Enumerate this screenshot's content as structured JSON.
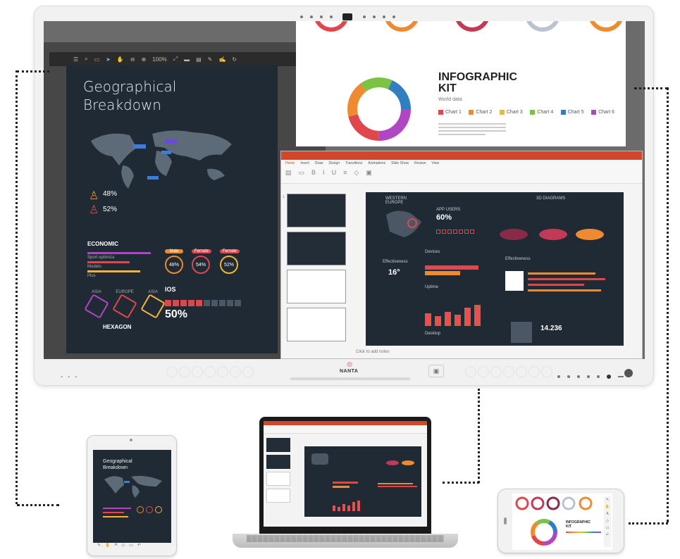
{
  "left_doc": {
    "title_line1": "Geographical",
    "title_line2": "Breakdown",
    "toolbar_zoom": "100%",
    "pct_male": "48%",
    "pct_female": "52%",
    "economic_label": "ECONOMIC",
    "economic_rows": [
      "Sport optimiza",
      "Modelo",
      "Plus"
    ],
    "ring_labels": [
      "Male",
      "Female",
      "Female"
    ],
    "ring_values": [
      "48%",
      "54%",
      "52%"
    ],
    "hex_labels": [
      "ASIA",
      "EUROPE",
      "ASIA"
    ],
    "hexagon_label": "HEXAGON",
    "ios_label": "IOS",
    "ios_value": "50%"
  },
  "info_slide": {
    "title_line1": "INFOGRAPHIC",
    "title_line2": "KIT",
    "subtitle": "World data",
    "legend": [
      "Chart 1",
      "Chart 2",
      "Chart 3",
      "Chart 4",
      "Chart 5",
      "Chart 6"
    ],
    "legend_colors": [
      "#e0474c",
      "#f08a2e",
      "#f3b43a",
      "#7cc243",
      "#2f7fc1",
      "#b146c2"
    ]
  },
  "ppt": {
    "tabs": [
      "Home",
      "Insert",
      "Draw",
      "Design",
      "Transitions",
      "Animations",
      "Slide Show",
      "Review",
      "View"
    ],
    "main": {
      "region_label": "WESTERN EUROPE",
      "app_users_label": "APP USERS",
      "app_users_value": "60%",
      "effectiveness_label": "Effectiveness",
      "temp_value": "16°",
      "devices_label": "Devices",
      "uptime_label": "Uptime",
      "desktop_label": "Desktop",
      "big_number": "14.236",
      "diagrams_label": "3D DIAGRAMS",
      "effectiveness_right_label": "Effectiveness"
    },
    "status_text": "Click to add notes"
  },
  "bezel": {
    "brand": "NANTA"
  },
  "tablet": {
    "title_line1": "Geographical",
    "title_line2": "Breakdown"
  },
  "phone": {
    "title_line1": "INFOGRAPHIC",
    "title_line2": "KIT"
  }
}
